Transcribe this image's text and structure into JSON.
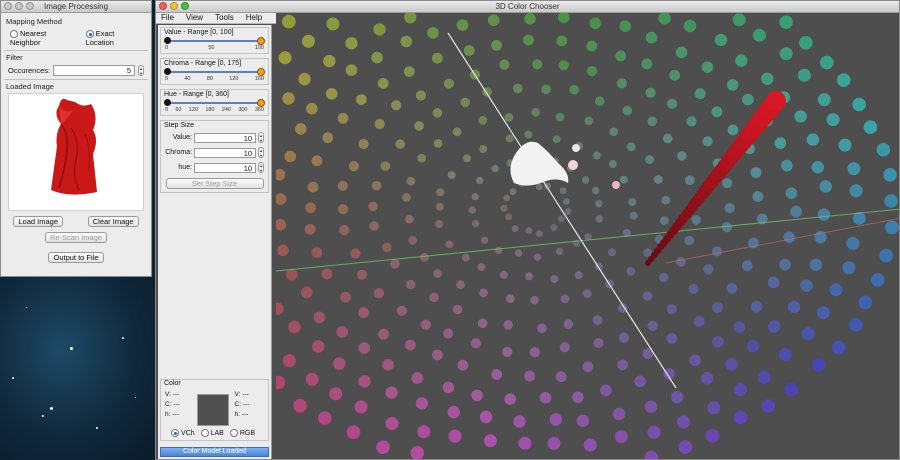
{
  "image_window": {
    "title": "Image Processing",
    "mapping": {
      "label": "Mapping Method",
      "options": [
        {
          "label": "Nearest Neighbor",
          "selected": false
        },
        {
          "label": "Exact Location",
          "selected": true
        }
      ]
    },
    "filter": {
      "label": "Filter",
      "occurrences_label": "Occurences:",
      "occurrences_value": "5"
    },
    "loaded_image_label": "Loaded Image",
    "buttons": {
      "load": "Load Image",
      "clear": "Clear Image",
      "rescan": "Re-Scan Image",
      "output": "Output to File"
    }
  },
  "main_window": {
    "title": "3D Color Chooser",
    "menu": [
      "File",
      "View",
      "Tools",
      "Help"
    ],
    "sliders": [
      {
        "label": "Value - Range [0, 100]",
        "ticks": [
          "0",
          "50",
          "100"
        ]
      },
      {
        "label": "Chroma - Range [0, 175]",
        "ticks": [
          "0",
          "40",
          "80",
          "120",
          "160"
        ]
      },
      {
        "label": "Hue - Range [0, 360]",
        "ticks": [
          "0",
          "60",
          "120",
          "180",
          "240",
          "300",
          "360"
        ]
      }
    ],
    "step_size": {
      "label": "Step Size",
      "value_label": "Value:",
      "value": "10",
      "chroma_label": "Chroma:",
      "chroma": "10",
      "hue_label": "hue:",
      "hue": "10",
      "button": "Set Step Size"
    },
    "color": {
      "label": "Color",
      "left": [
        {
          "k": "V:",
          "v": "---"
        },
        {
          "k": "C:",
          "v": "---"
        },
        {
          "k": "h:",
          "v": "---"
        }
      ],
      "right": [
        {
          "k": "V:",
          "v": "---"
        },
        {
          "k": "C:",
          "v": "---"
        },
        {
          "k": "h:",
          "v": "---"
        }
      ],
      "models": [
        {
          "label": "VCh",
          "selected": true
        },
        {
          "label": "LAB",
          "selected": false
        },
        {
          "label": "RGB",
          "selected": false
        }
      ]
    },
    "status": "Color Model Loaded"
  }
}
